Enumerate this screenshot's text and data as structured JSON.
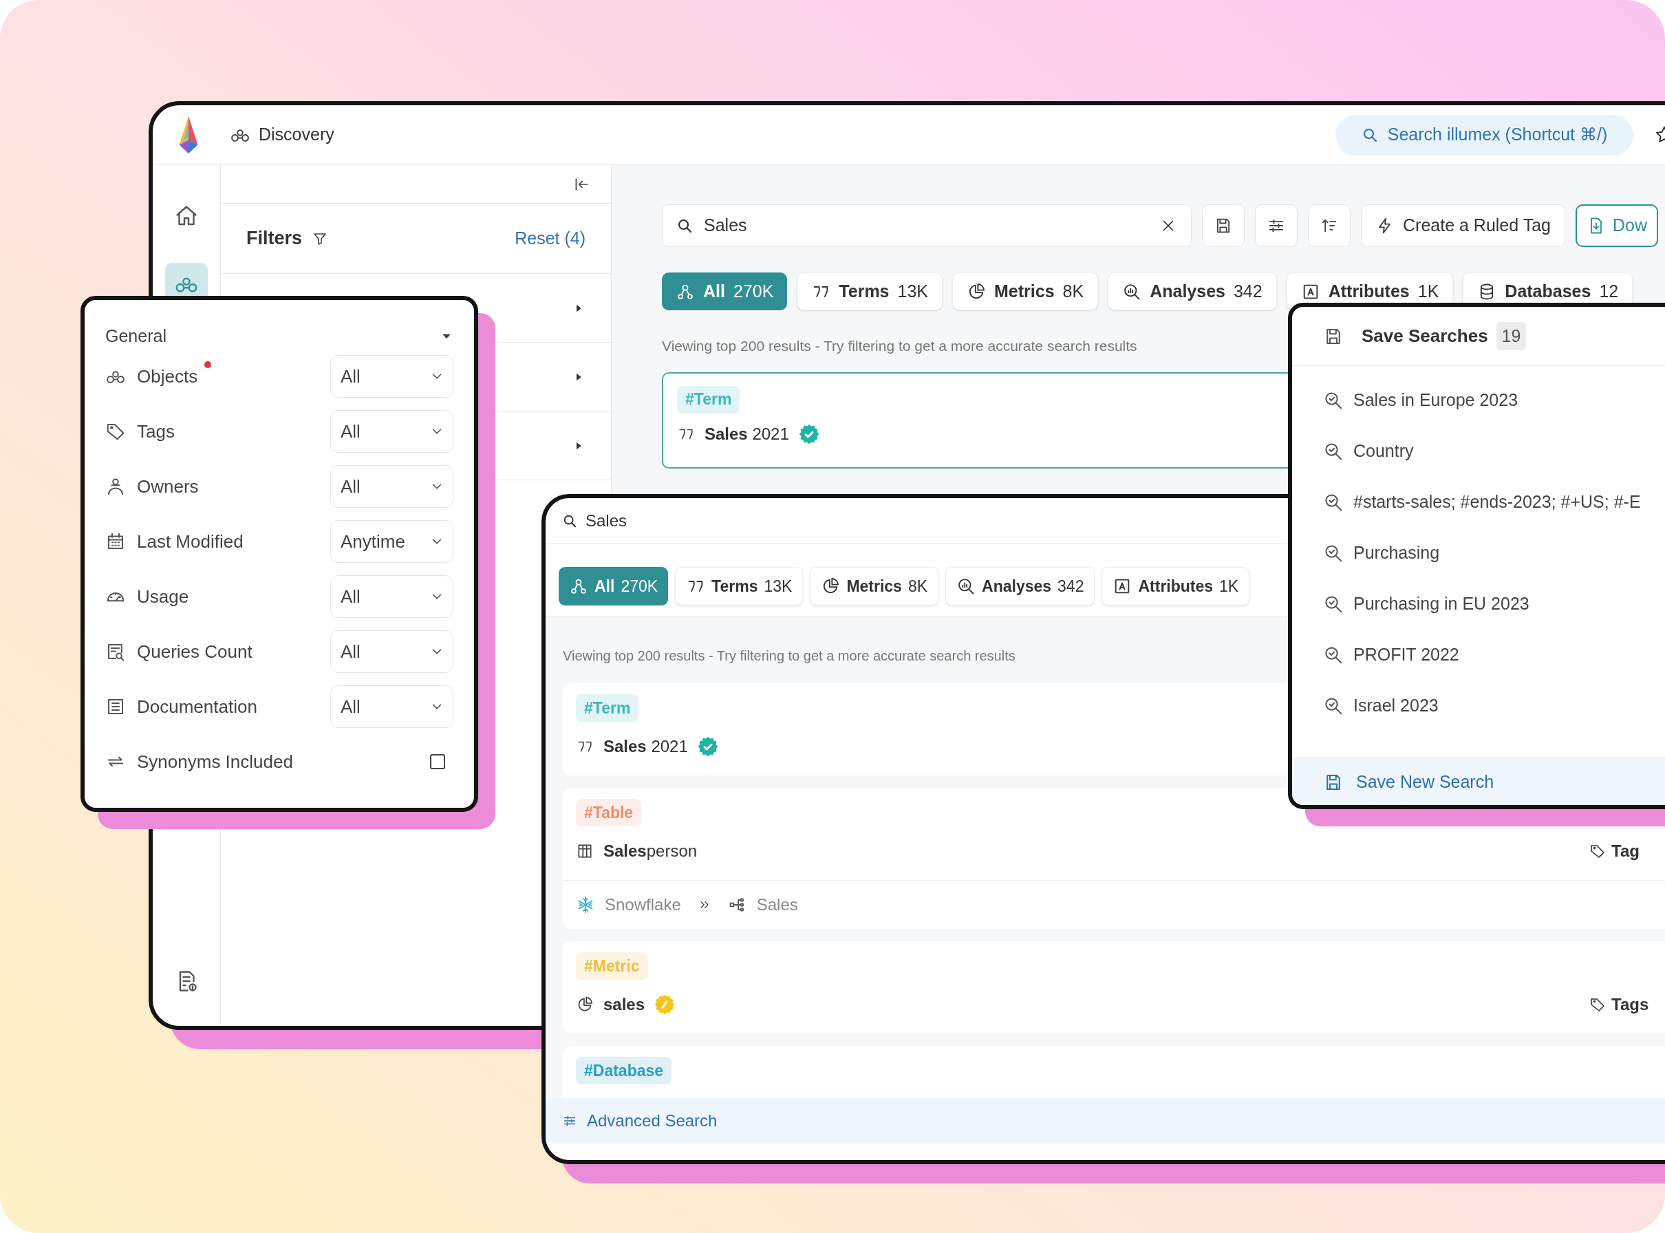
{
  "app": {
    "title": "Discovery",
    "search_placeholder": "Search illumex (Shortcut ⌘/)"
  },
  "nav": [
    {
      "kind": "home",
      "selected": false
    },
    {
      "kind": "discovery",
      "selected": true
    },
    {
      "kind": "docs",
      "selected": false
    }
  ],
  "filters": {
    "title": "Filters",
    "reset": "Reset (4)",
    "sections": [
      {
        "expanded": false
      },
      {
        "expanded": false
      },
      {
        "expanded": false
      }
    ]
  },
  "search": {
    "value": "Sales",
    "ruled_tag_button": "Create a Ruled Tag",
    "download_button": "Dow"
  },
  "tabs": [
    {
      "kind": "all",
      "label": "All",
      "count": "270K",
      "selected": true
    },
    {
      "kind": "terms",
      "label": "Terms",
      "count": "13K",
      "selected": false
    },
    {
      "kind": "metrics",
      "label": "Metrics",
      "count": "8K",
      "selected": false
    },
    {
      "kind": "analyses",
      "label": "Analyses",
      "count": "342",
      "selected": false
    },
    {
      "kind": "attributes",
      "label": "Attributes",
      "count": "1K",
      "selected": false
    },
    {
      "kind": "databases",
      "label": "Databases",
      "count": "12",
      "selected": false
    }
  ],
  "info": "Viewing top 200 results - Try filtering to get a more accurate search results",
  "results": [
    {
      "kind": "term",
      "tag": "#Term",
      "color": "#3bb8bd",
      "name": "**Sales** 2021",
      "badge": {
        "kind": "verified"
      }
    }
  ],
  "filter_popup": {
    "section": "General",
    "rows": [
      {
        "kind": "objects",
        "label": "Objects",
        "value": "All",
        "modified": true
      },
      {
        "kind": "tags",
        "label": "Tags",
        "value": "All",
        "modified": false
      },
      {
        "kind": "owners",
        "label": "Owners",
        "value": "All",
        "modified": false
      },
      {
        "kind": "modified",
        "label": "Last Modified",
        "value": "Anytime",
        "modified": false
      },
      {
        "kind": "usage",
        "label": "Usage",
        "value": "All",
        "modified": false
      },
      {
        "kind": "queries",
        "label": "Queries Count",
        "value": "All",
        "modified": false
      },
      {
        "kind": "documentation",
        "label": "Documentation",
        "value": "All",
        "modified": false
      }
    ],
    "synonyms": {
      "label": "Synonyms Included",
      "checked": false
    }
  },
  "panel": {
    "search": "Sales",
    "tabs": [
      {
        "kind": "all",
        "label": "All",
        "count": "270K",
        "selected": true
      },
      {
        "kind": "terms",
        "label": "Terms",
        "count": "13K",
        "selected": false
      },
      {
        "kind": "metrics",
        "label": "Metrics",
        "count": "8K",
        "selected": false
      },
      {
        "kind": "analyses",
        "label": "Analyses",
        "count": "342",
        "selected": false
      },
      {
        "kind": "attributes",
        "label": "Attributes",
        "count": "1K",
        "selected": false
      }
    ],
    "info": "Viewing top 200 results - Try filtering to get a more accurate search results",
    "results": [
      {
        "kind": "term",
        "tag": "#Term",
        "color": "#3bb8bd",
        "name": "**Sales** 2021",
        "badge": {
          "kind": "verified"
        }
      },
      {
        "kind": "table",
        "tag": "#Table",
        "color": "#f08d6c",
        "name": "**Sales**person",
        "tags_label": "Tag",
        "path": [
          {
            "kind": "snowflake",
            "label": "Snowflake"
          },
          {
            "kind": "schema",
            "label": "Sales"
          }
        ]
      },
      {
        "kind": "metric",
        "tag": "#Metric",
        "color": "#f3bd3a",
        "name": "**sales**",
        "badge": {
          "kind": "pending"
        },
        "tags_label": "Tags"
      },
      {
        "kind": "database",
        "tag": "#Database",
        "color": "#2a9dc8"
      }
    ],
    "advanced": "Advanced Search"
  },
  "saved_searches": {
    "title": "Save Searches",
    "count": "19",
    "items": [
      "Sales in Europe 2023",
      "Country",
      "#starts-sales; #ends-2023; #+US; #-E",
      "Purchasing",
      "Purchasing in EU 2023",
      "PROFIT 2022",
      "Israel 2023"
    ],
    "save_new": "Save New Search"
  }
}
